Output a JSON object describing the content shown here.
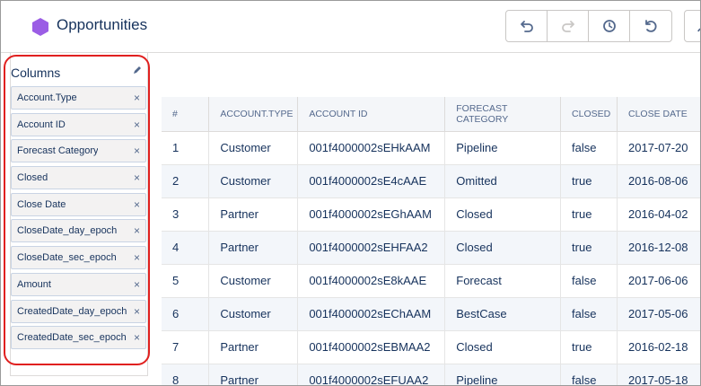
{
  "header": {
    "title": "Opportunities",
    "brand_color": "#9b5de5",
    "toolbar": [
      {
        "icon": "undo-icon"
      },
      {
        "icon": "redo-icon"
      },
      {
        "icon": "history-icon"
      },
      {
        "icon": "reset-icon"
      }
    ]
  },
  "columns_panel": {
    "title": "Columns",
    "items": [
      {
        "label": "Account.Type"
      },
      {
        "label": "Account ID"
      },
      {
        "label": "Forecast Category"
      },
      {
        "label": "Closed"
      },
      {
        "label": "Close Date"
      },
      {
        "label": "CloseDate_day_epoch"
      },
      {
        "label": "CloseDate_sec_epoch"
      },
      {
        "label": "Amount"
      },
      {
        "label": "CreatedDate_day_epoch"
      },
      {
        "label": "CreatedDate_sec_epoch"
      }
    ],
    "remove_glyph": "×"
  },
  "table": {
    "headers": [
      "#",
      "ACCOUNT.TYPE",
      "ACCOUNT ID",
      "FORECAST CATEGORY",
      "CLOSED",
      "CLOSE DATE"
    ],
    "rows": [
      [
        "1",
        "Customer",
        "001f4000002sEHkAAM",
        "Pipeline",
        "false",
        "2017-07-20"
      ],
      [
        "2",
        "Customer",
        "001f4000002sE4cAAE",
        "Omitted",
        "true",
        "2016-08-06"
      ],
      [
        "3",
        "Partner",
        "001f4000002sEGhAAM",
        "Closed",
        "true",
        "2016-04-02"
      ],
      [
        "4",
        "Partner",
        "001f4000002sEHFAA2",
        "Closed",
        "true",
        "2016-12-08"
      ],
      [
        "5",
        "Customer",
        "001f4000002sE8kAAE",
        "Forecast",
        "false",
        "2017-06-06"
      ],
      [
        "6",
        "Customer",
        "001f4000002sEChAAM",
        "BestCase",
        "false",
        "2017-05-06"
      ],
      [
        "7",
        "Partner",
        "001f4000002sEBMAA2",
        "Closed",
        "true",
        "2016-02-18"
      ],
      [
        "8",
        "Partner",
        "001f4000002sEFUAA2",
        "Pipeline",
        "false",
        "2017-05-18"
      ]
    ]
  }
}
